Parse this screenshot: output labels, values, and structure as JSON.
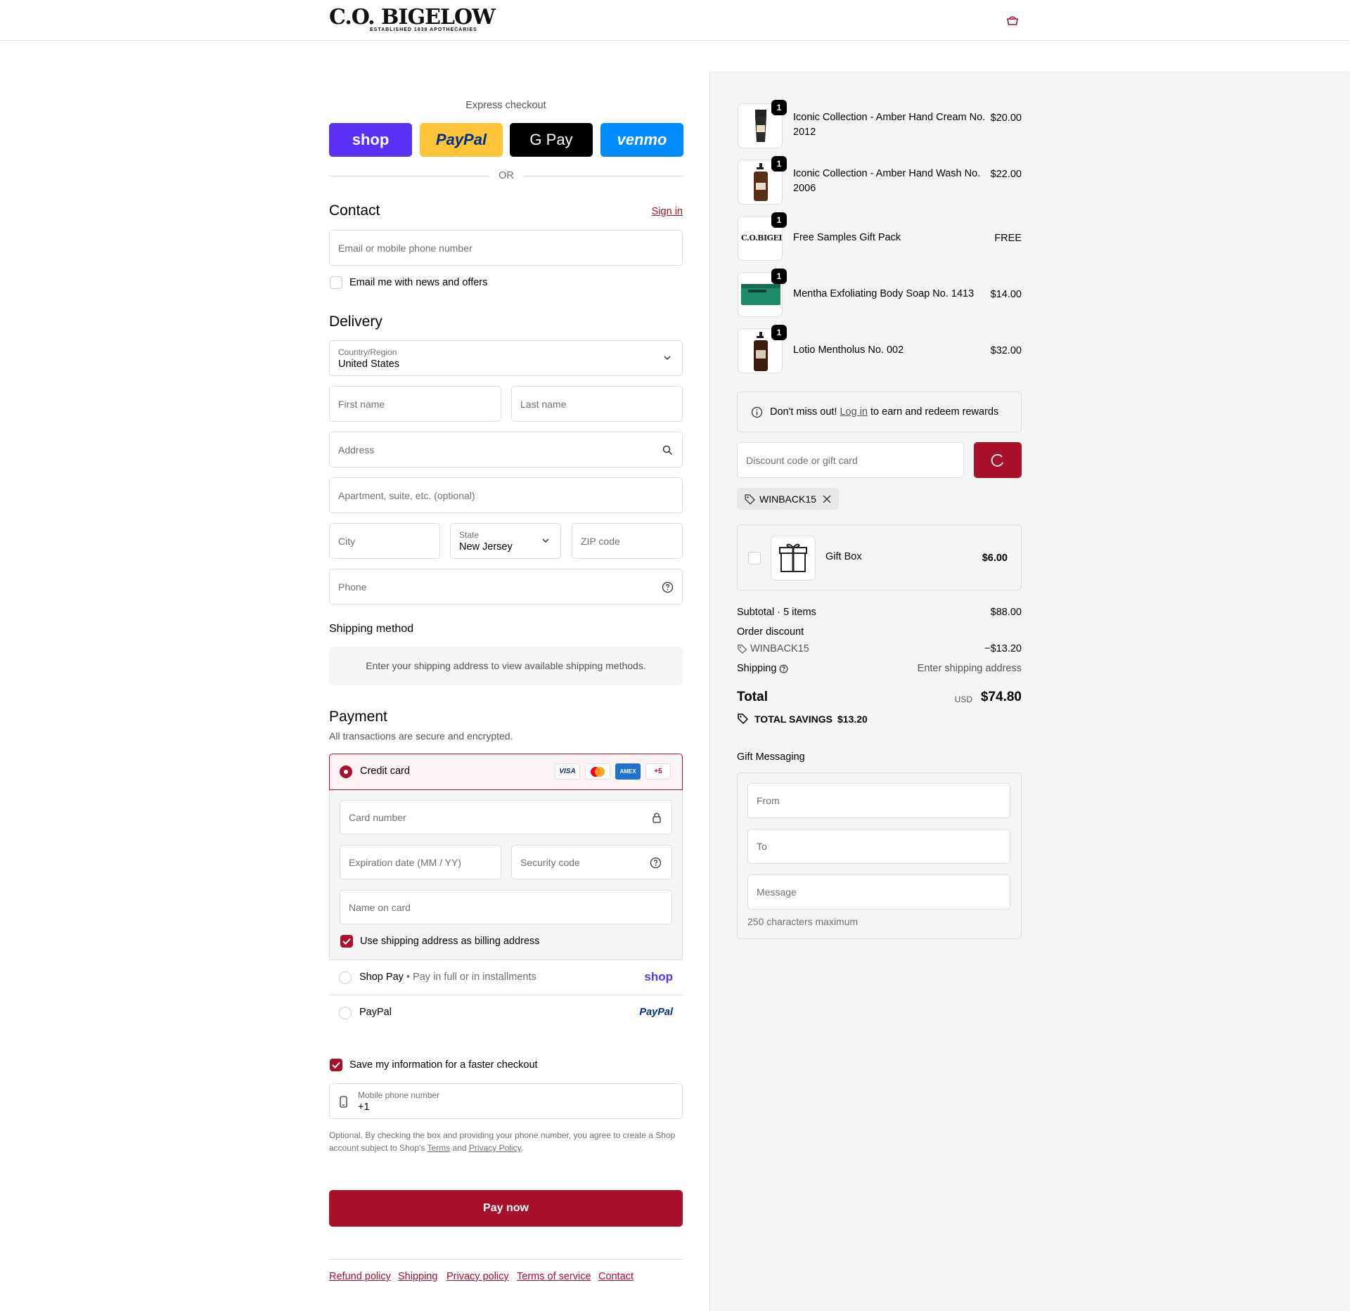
{
  "brand": {
    "logo_main": "C.O. BIGELOW",
    "logo_sub": "ESTABLISHED 1838 APOTHECARIES"
  },
  "express": {
    "title": "Express checkout",
    "shop_label": "shop",
    "paypal_label": "PayPal",
    "gpay_label": "G Pay",
    "venmo_label": "venmo",
    "or_label": "OR"
  },
  "contact": {
    "heading": "Contact",
    "sign_in": "Sign in",
    "email_placeholder": "Email or mobile phone number",
    "news_label": "Email me with news and offers"
  },
  "delivery": {
    "heading": "Delivery",
    "country_label": "Country/Region",
    "country_value": "United States",
    "first_name": "First name",
    "last_name": "Last name",
    "address": "Address",
    "apartment": "Apartment, suite, etc. (optional)",
    "city": "City",
    "state_label": "State",
    "state_value": "New Jersey",
    "zip": "ZIP code",
    "phone": "Phone"
  },
  "shipping_method": {
    "heading": "Shipping method",
    "message": "Enter your shipping address to view available shipping methods."
  },
  "payment": {
    "heading": "Payment",
    "subtitle": "All transactions are secure and encrypted.",
    "credit_card_label": "Credit card",
    "card_logos": [
      "VISA",
      "MC",
      "AMEX",
      "+5"
    ],
    "card_number": "Card number",
    "expiration": "Expiration date (MM / YY)",
    "security_code": "Security code",
    "name_on_card": "Name on card",
    "billing_same": "Use shipping address as billing address",
    "shop_pay_label": "Shop Pay",
    "shop_pay_sub": "Pay in full or in installments",
    "shop_pay_logo": "shop",
    "paypal_label": "PayPal",
    "paypal_logo": "PayPal"
  },
  "save_info": {
    "label": "Save my information for a faster checkout",
    "mobile_label": "Mobile phone number",
    "mobile_value": "+1",
    "legal_1": "Optional. By checking the box and providing your phone number, you agree to create a Shop",
    "legal_2": "account subject to Shop's",
    "terms": "Terms",
    "and": "and",
    "privacy": "Privacy Policy",
    "period": "."
  },
  "pay_now": "Pay now",
  "footer_links": [
    "Refund policy",
    "Shipping",
    "Privacy policy",
    "Terms of service",
    "Contact"
  ],
  "order": {
    "items": [
      {
        "name": "Iconic Collection - Amber Hand Cream No. 2012",
        "price": "$20.00",
        "qty": "1"
      },
      {
        "name": "Iconic Collection - Amber Hand Wash No. 2006",
        "price": "$22.00",
        "qty": "1"
      },
      {
        "name": "Free Samples Gift Pack",
        "price": "FREE",
        "qty": "1"
      },
      {
        "name": "Mentha Exfoliating Body Soap No. 1413",
        "price": "$14.00",
        "qty": "1"
      },
      {
        "name": "Lotio Mentholus No. 002",
        "price": "$32.00",
        "qty": "1"
      }
    ],
    "rewards_pre": "Don't miss out!",
    "rewards_link": "Log in",
    "rewards_post": "to earn and redeem rewards",
    "discount_placeholder": "Discount code or gift card",
    "applied_code": "WINBACK15",
    "gift_box_label": "Gift Box",
    "gift_box_price": "$6.00",
    "subtotal_label": "Subtotal · 5 items",
    "subtotal_value": "$88.00",
    "order_discount_label": "Order discount",
    "discount_code": "WINBACK15",
    "discount_value": "−$13.20",
    "shipping_label": "Shipping",
    "shipping_value": "Enter shipping address",
    "total_label": "Total",
    "currency": "USD",
    "total_value": "$74.80",
    "savings_label": "TOTAL SAVINGS",
    "savings_value": "$13.20"
  },
  "gift_messaging": {
    "heading": "Gift Messaging",
    "from": "From",
    "to": "To",
    "message": "Message",
    "hint": "250 characters maximum"
  },
  "colors": {
    "accent": "#a8102b",
    "shop": "#5a31f4",
    "paypal": "#ffc439",
    "venmo": "#008cff",
    "panel_bg": "#f5f5f5"
  }
}
